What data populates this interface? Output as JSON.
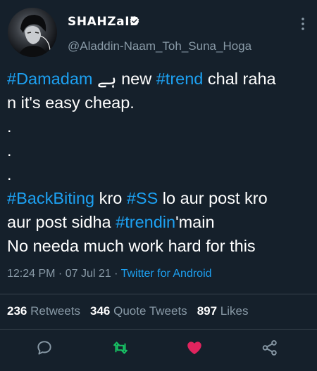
{
  "user": {
    "display_name": "SHAHZaIB",
    "handle": "@Aladdin-Naam_Toh_Suna_Hoga",
    "verified": true
  },
  "tweet": {
    "line1": {
      "tag1": "#Damadam",
      "text1": " ہے new ",
      "tag2": "#trend",
      "text2": " chal raha"
    },
    "line2": "n it's easy cheap.",
    "dot": ".",
    "line4": {
      "tag1": "#BackBiting",
      "text1": " kro ",
      "tag2": "#SS",
      "text2": " lo aur post kro"
    },
    "line5": {
      "text1": "aur post sidha ",
      "tag": "#trendin",
      "text2": "'main"
    },
    "line6": "No needa much work hard for this"
  },
  "meta": {
    "time": "12:24 PM",
    "sep1": " · ",
    "date": "07 Jul 21",
    "sep2": " · ",
    "source": "Twitter for Android"
  },
  "stats": {
    "retweets_count": "236",
    "retweets_label": "Retweets",
    "quotes_count": "346",
    "quotes_label": "Quote Tweets",
    "likes_count": "897",
    "likes_label": "Likes"
  },
  "colors": {
    "background": "#15202b",
    "accent": "#1da1f2",
    "muted": "#8899a6",
    "retweet": "#17bf63",
    "like": "#e0245e"
  },
  "icons": [
    "verified-badge-icon",
    "more-vertical-icon",
    "reply-icon",
    "retweet-icon",
    "like-icon",
    "share-icon"
  ]
}
